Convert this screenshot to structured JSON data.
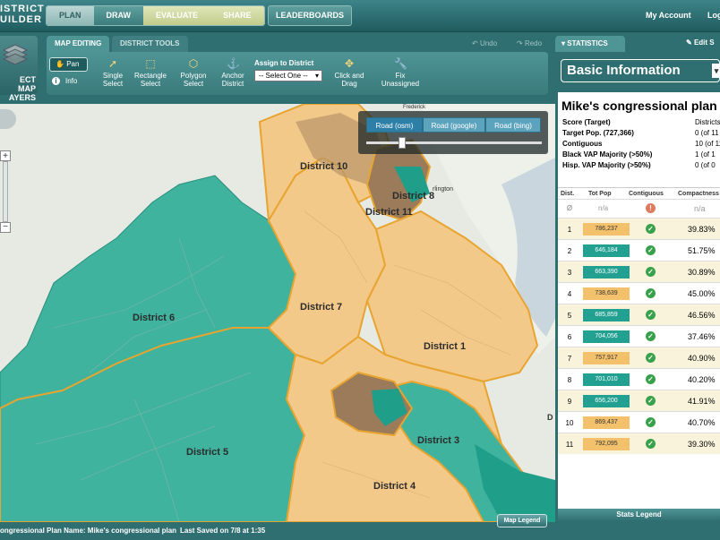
{
  "app": {
    "logo_line1": "ISTRICT",
    "logo_line2": "UILDER"
  },
  "workflow": {
    "steps": [
      "PLAN",
      "DRAW",
      "EVALUATE",
      "SHARE"
    ],
    "leaderboards": "LEADERBOARDS"
  },
  "account": {
    "my_account": "My Account",
    "logout": "Log"
  },
  "map_layers": {
    "line1": "ECT MAP",
    "line2": "AYERS"
  },
  "tabs": {
    "map_editing": "MAP EDITING",
    "district_tools": "DISTRICT TOOLS"
  },
  "undo": "Undo",
  "redo": "Redo",
  "tools": {
    "pan": "Pan",
    "info": "Info",
    "single_select": [
      "Single",
      "Select"
    ],
    "rectangle_select": [
      "Rectangle",
      "Select"
    ],
    "polygon_select": [
      "Polygon",
      "Select"
    ],
    "anchor_district": [
      "Anchor",
      "District"
    ],
    "assign_label": "Assign to District",
    "assign_value": "-- Select One --",
    "click_drag": [
      "Click and",
      "Drag"
    ],
    "fix_unassigned": [
      "Fix",
      "Unassigned"
    ]
  },
  "basemap": {
    "options": [
      "Road (osm)",
      "Road (google)",
      "Road (bing)"
    ],
    "selected": "Road (osm)"
  },
  "map_labels": {
    "d10": "District 10",
    "d8": "District 8",
    "d11": "District 11",
    "d7": "District 7",
    "d6": "District 6",
    "d1": "District 1",
    "d5": "District 5",
    "d3": "District 3",
    "d4": "District 4",
    "frederick": "Frederick",
    "arlington": "rlington",
    "edge_d": "D"
  },
  "status": {
    "plan_name": "ongressional Plan Name: Mike's congressional plan",
    "saved": "Last Saved on 7/8 at 1:35"
  },
  "map_legend": "Map Legend",
  "statistics": {
    "tab": "STATISTICS",
    "edit": "Edit S",
    "dropdown": "Basic Information",
    "plan_title": "Mike's congressional plan",
    "summary": [
      {
        "label": "Score (Target)",
        "value": "Districts"
      },
      {
        "label": "Target Pop. (727,366)",
        "value": "0 (of 11"
      },
      {
        "label": "Contiguous",
        "value": "10 (of 11"
      },
      {
        "label": "Black VAP Majority (>50%)",
        "value": "1 (of 1"
      },
      {
        "label": "Hisp. VAP Majority (>50%)",
        "value": "0 (of 0"
      }
    ],
    "columns": [
      "Dist.",
      "Tot Pop",
      "Contiguous",
      "Compactness"
    ],
    "unassigned": {
      "dist": "Ø",
      "pop": "n/a",
      "compact": "n/a"
    },
    "rows": [
      {
        "dist": "1",
        "pop": "786,237",
        "compact": "39.83%",
        "color": "#f3c06b"
      },
      {
        "dist": "2",
        "pop": "646,184",
        "compact": "51.75%",
        "color": "#22a091"
      },
      {
        "dist": "3",
        "pop": "663,390",
        "compact": "30.89%",
        "color": "#22a091"
      },
      {
        "dist": "4",
        "pop": "738,639",
        "compact": "45.00%",
        "color": "#f3c06b"
      },
      {
        "dist": "5",
        "pop": "685,859",
        "compact": "46.56%",
        "color": "#22a091"
      },
      {
        "dist": "6",
        "pop": "704,056",
        "compact": "37.46%",
        "color": "#22a091"
      },
      {
        "dist": "7",
        "pop": "757,917",
        "compact": "40.90%",
        "color": "#f3c06b"
      },
      {
        "dist": "8",
        "pop": "701,010",
        "compact": "40.20%",
        "color": "#22a091"
      },
      {
        "dist": "9",
        "pop": "656,200",
        "compact": "41.91%",
        "color": "#22a091"
      },
      {
        "dist": "10",
        "pop": "869,437",
        "compact": "40.70%",
        "color": "#f3c06b"
      },
      {
        "dist": "11",
        "pop": "792,095",
        "compact": "39.30%",
        "color": "#f3c06b"
      }
    ],
    "legend": "Stats Legend"
  }
}
